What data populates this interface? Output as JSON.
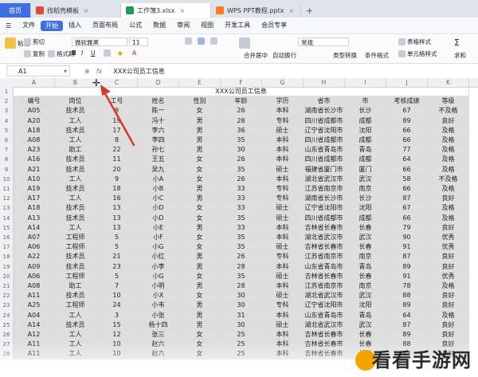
{
  "tabs": [
    {
      "label": "首页",
      "kind": "home"
    },
    {
      "label": "找稻壳模板",
      "kind": "normal",
      "icon_color": "#e0483a"
    },
    {
      "label": "工作簿3.xlsx",
      "kind": "active",
      "icon_color": "#1f9d55"
    },
    {
      "label": "WPS PPT教程.pptx",
      "kind": "normal",
      "icon_color": "#ff7a1a"
    }
  ],
  "new_tab_glyph": "+",
  "menu": [
    "文件",
    "开始",
    "插入",
    "页面布局",
    "公式",
    "数据",
    "审阅",
    "视图",
    "开发工具",
    "会员专享"
  ],
  "ribbon": {
    "paste": "粘贴",
    "cut": "剪切",
    "copy": "复制",
    "format_painter": "格式刷",
    "font_name": "微软雅黑",
    "font_size": "11",
    "merge": "合并居中",
    "wrap": "自动换行",
    "number_format": "常规",
    "type_convert": "类型转换",
    "conditional": "条件格式",
    "table_style": "表格样式",
    "cell_style": "单元格样式",
    "sum": "求和"
  },
  "formula": {
    "name": "A1",
    "fx": "fx",
    "content": "XXX公司员工信息"
  },
  "columns": [
    "A",
    "B",
    "C",
    "D",
    "E",
    "F",
    "G",
    "H",
    "I",
    "J",
    "K"
  ],
  "title": "XXX公司员工信息",
  "headers": [
    "编号",
    "岗位",
    "工号",
    "姓名",
    "性别",
    "年龄",
    "学历",
    "省市",
    "市",
    "考核成绩",
    "等级"
  ],
  "rows": [
    [
      "A05",
      "技术员",
      "9",
      "陈一",
      "女",
      "26",
      "本科",
      "湖南省长沙市",
      "长沙",
      "67",
      "不及格"
    ],
    [
      "A20",
      "工人",
      "19",
      "冯十",
      "男",
      "28",
      "专科",
      "四川省成都市",
      "成都",
      "89",
      "良好"
    ],
    [
      "A18",
      "技术员",
      "17",
      "李六",
      "男",
      "36",
      "硕士",
      "辽宁省沈阳市",
      "沈阳",
      "66",
      "及格"
    ],
    [
      "A08",
      "工人",
      "8",
      "李四",
      "男",
      "35",
      "本科",
      "四川省成都市",
      "成都",
      "66",
      "及格"
    ],
    [
      "A23",
      "助工",
      "22",
      "孙七",
      "男",
      "30",
      "本科",
      "山东省青岛市",
      "青岛",
      "77",
      "及格"
    ],
    [
      "A16",
      "技术员",
      "11",
      "王五",
      "女",
      "26",
      "本科",
      "四川省成都市",
      "成都",
      "64",
      "及格"
    ],
    [
      "A21",
      "技术员",
      "20",
      "吴九",
      "女",
      "35",
      "硕士",
      "福建省厦门市",
      "厦门",
      "66",
      "及格"
    ],
    [
      "A10",
      "工人",
      "9",
      "小A",
      "女",
      "26",
      "本科",
      "湖北省武汉市",
      "武汉",
      "58",
      "不及格"
    ],
    [
      "A19",
      "技术员",
      "18",
      "小B",
      "男",
      "33",
      "专科",
      "江苏省南京市",
      "南京",
      "66",
      "及格"
    ],
    [
      "A17",
      "工人",
      "16",
      "小C",
      "男",
      "33",
      "专科",
      "湖南省长沙市",
      "长沙",
      "87",
      "良好"
    ],
    [
      "A18",
      "技术员",
      "13",
      "小D",
      "女",
      "33",
      "硕士",
      "辽宁省沈阳市",
      "沈阳",
      "67",
      "及格"
    ],
    [
      "A13",
      "技术员",
      "13",
      "小D",
      "女",
      "35",
      "硕士",
      "四川省成都市",
      "成都",
      "66",
      "及格"
    ],
    [
      "A14",
      "工人",
      "13",
      "小E",
      "男",
      "33",
      "本科",
      "吉林省长春市",
      "长春",
      "79",
      "良好"
    ],
    [
      "A07",
      "工程师",
      "5",
      "小F",
      "女",
      "35",
      "本科",
      "湖北省武汉市",
      "武汉",
      "90",
      "优秀"
    ],
    [
      "A06",
      "工程师",
      "5",
      "小G",
      "女",
      "35",
      "硕士",
      "吉林省长春市",
      "长春",
      "91",
      "优秀"
    ],
    [
      "A22",
      "技术员",
      "21",
      "小红",
      "男",
      "26",
      "专科",
      "江苏省南京市",
      "南京",
      "87",
      "良好"
    ],
    [
      "A09",
      "技术员",
      "23",
      "小李",
      "男",
      "28",
      "本科",
      "山东省青岛市",
      "青岛",
      "89",
      "良好"
    ],
    [
      "A06",
      "工程师",
      "5",
      "小G",
      "女",
      "35",
      "硕士",
      "吉林省长春市",
      "长春",
      "91",
      "优秀"
    ],
    [
      "A08",
      "助工",
      "7",
      "小明",
      "男",
      "28",
      "本科",
      "江苏省南京市",
      "南京",
      "78",
      "及格"
    ],
    [
      "A11",
      "技术员",
      "10",
      "小X",
      "女",
      "30",
      "硕士",
      "湖北省武汉市",
      "武汉",
      "88",
      "良好"
    ],
    [
      "A25",
      "工程师",
      "24",
      "小韦",
      "男",
      "30",
      "专科",
      "辽宁省沈阳市",
      "沈阳",
      "89",
      "良好"
    ],
    [
      "A04",
      "工人",
      "3",
      "小张",
      "男",
      "31",
      "本科",
      "山东省青岛市",
      "青岛",
      "64",
      "及格"
    ],
    [
      "A14",
      "技术员",
      "15",
      "杨十四",
      "男",
      "30",
      "硕士",
      "湖北省武汉市",
      "武汉",
      "87",
      "良好"
    ],
    [
      "A12",
      "工人",
      "12",
      "张三",
      "女",
      "25",
      "本科",
      "吉林省长春市",
      "长春",
      "89",
      "良好"
    ],
    [
      "A11",
      "工人",
      "10",
      "赵六",
      "女",
      "25",
      "本科",
      "吉林省长春市",
      "长春",
      "88",
      "良好"
    ],
    [
      "A11",
      "工人",
      "10",
      "赵六",
      "女",
      "25",
      "本科",
      "吉林省长春市",
      "长春",
      "88",
      "良好"
    ]
  ],
  "watermark": "看看手游网"
}
